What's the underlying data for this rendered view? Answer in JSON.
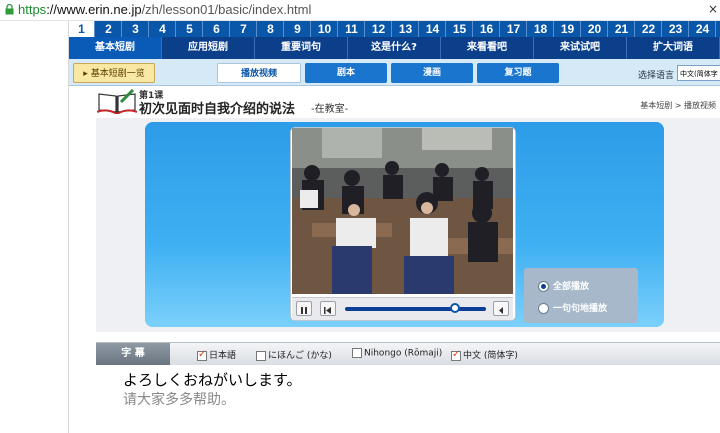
{
  "browser": {
    "url_scheme": "https",
    "url_host": "://www.erin.ne.jp",
    "url_path": "/zh/lesson01/basic/index.html"
  },
  "lessons": [
    "1",
    "2",
    "3",
    "4",
    "5",
    "6",
    "7",
    "8",
    "9",
    "10",
    "11",
    "12",
    "13",
    "14",
    "15",
    "16",
    "17",
    "18",
    "19",
    "20",
    "21",
    "22",
    "23",
    "24"
  ],
  "active_lesson": "1",
  "nav": [
    "基本短剧",
    "应用短剧",
    "重要词句",
    "这是什么?",
    "来看看吧",
    "来试试吧",
    "扩大词语"
  ],
  "subnav": {
    "crumb": "基本短剧一览",
    "tabs": [
      "播放视频",
      "剧本",
      "漫画",
      "复习题"
    ],
    "lang_label": "选择语言",
    "lang_value": "中文(简体字"
  },
  "title": {
    "lesson_no": "第1课",
    "main": "初次见面时自我介绍的说法",
    "sub": "-在教室-",
    "breadcrumb_a": "基本短剧",
    "breadcrumb_sep": ">",
    "breadcrumb_b": "播放视频"
  },
  "playback": {
    "mode_all": "全部播放",
    "mode_line": "一句句地播放",
    "selected": "全部播放",
    "progress": 0.78
  },
  "subtitles": {
    "label": "字 幕",
    "opt_nihongo": "日本語",
    "opt_kana": "にほんご (かな)",
    "opt_romaji": "Nihongo (Rōmaji)",
    "opt_chinese": "中文 (简体字)",
    "line_jp": "よろしくおねがいします。",
    "line_cn": "请大家多多帮助。"
  },
  "colors": {
    "nav_blue": "#0b3f8a",
    "lesson_blue": "#0a56a8",
    "panel_blue": "#38a8ee"
  }
}
